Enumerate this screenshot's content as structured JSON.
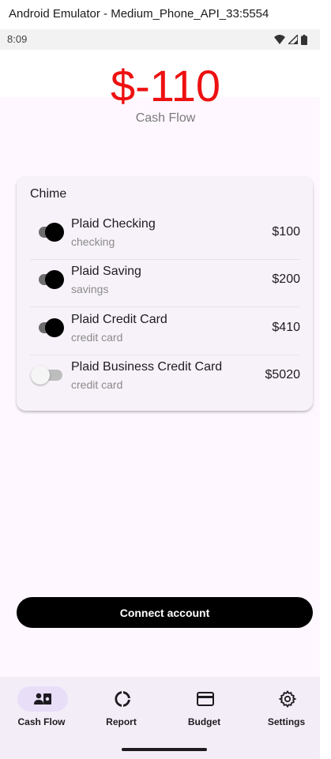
{
  "window": {
    "title": "Android Emulator - Medium_Phone_API_33:5554"
  },
  "status_bar": {
    "time": "8:09",
    "icons": [
      "wifi-icon",
      "signal-icon",
      "battery-icon"
    ]
  },
  "summary": {
    "amount": "$-110",
    "label": "Cash Flow",
    "amount_color": "#ee1111"
  },
  "institution": {
    "name": "Chime",
    "accounts": [
      {
        "name": "Plaid Checking",
        "type": "checking",
        "amount": "$100",
        "enabled": true
      },
      {
        "name": "Plaid Saving",
        "type": "savings",
        "amount": "$200",
        "enabled": true
      },
      {
        "name": "Plaid Credit Card",
        "type": "credit card",
        "amount": "$410",
        "enabled": true
      },
      {
        "name": "Plaid Business Credit Card",
        "type": "credit card",
        "amount": "$5020",
        "enabled": false
      }
    ]
  },
  "actions": {
    "connect_label": "Connect account"
  },
  "bottom_nav": {
    "active": 0,
    "items": [
      {
        "label": "Cash Flow",
        "icon": "cash-flow-icon"
      },
      {
        "label": "Report",
        "icon": "report-icon"
      },
      {
        "label": "Budget",
        "icon": "budget-icon"
      },
      {
        "label": "Settings",
        "icon": "settings-icon"
      }
    ]
  }
}
